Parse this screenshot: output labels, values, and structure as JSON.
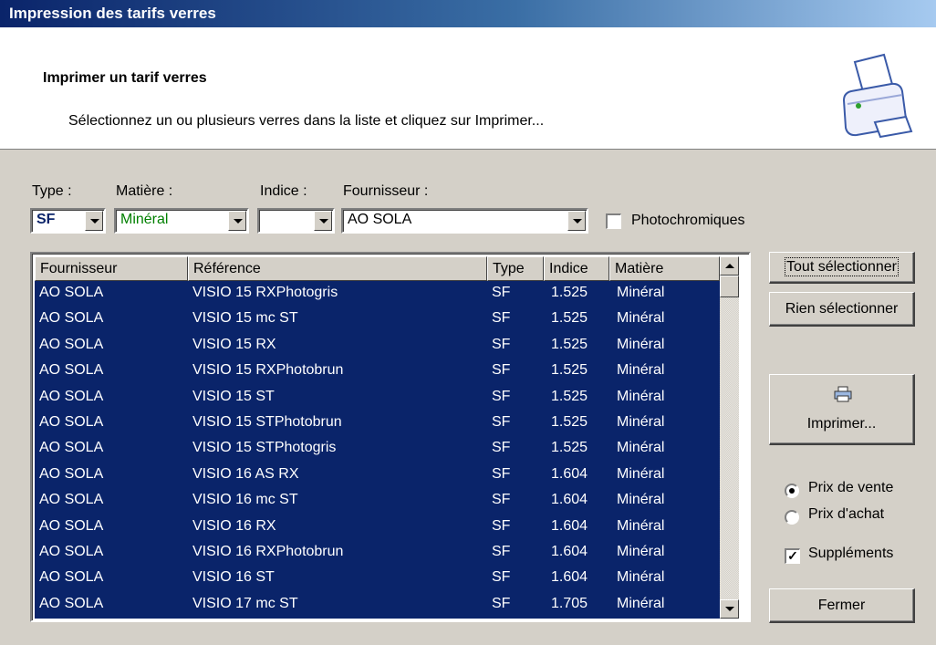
{
  "window": {
    "title": "Impression des tarifs verres"
  },
  "header": {
    "title": "Imprimer un tarif verres",
    "subtitle": "Sélectionnez un ou plusieurs verres dans la liste et cliquez sur Imprimer...",
    "icon": "printer-icon"
  },
  "filters": {
    "type_label": "Type :",
    "type_value": "SF",
    "matiere_label": "Matière :",
    "matiere_value": "Minéral",
    "indice_label": "Indice :",
    "indice_value": "",
    "fournisseur_label": "Fournisseur :",
    "fournisseur_value": "AO SOLA",
    "photochromiques_label": "Photochromiques",
    "photochromiques_checked": false
  },
  "list": {
    "columns": [
      "Fournisseur",
      "Référence",
      "Type",
      "Indice",
      "Matière"
    ],
    "rows": [
      [
        "AO SOLA",
        "VISIO 15  RXPhotogris",
        "SF",
        "1.525",
        "Minéral"
      ],
      [
        "AO SOLA",
        "VISIO 15 mc ST",
        "SF",
        "1.525",
        "Minéral"
      ],
      [
        "AO SOLA",
        "VISIO 15 RX",
        "SF",
        "1.525",
        "Minéral"
      ],
      [
        "AO SOLA",
        "VISIO 15 RXPhotobrun",
        "SF",
        "1.525",
        "Minéral"
      ],
      [
        "AO SOLA",
        "VISIO 15 ST",
        "SF",
        "1.525",
        "Minéral"
      ],
      [
        "AO SOLA",
        "VISIO 15 STPhotobrun",
        "SF",
        "1.525",
        "Minéral"
      ],
      [
        "AO SOLA",
        "VISIO 15 STPhotogris",
        "SF",
        "1.525",
        "Minéral"
      ],
      [
        "AO SOLA",
        "VISIO 16 AS RX",
        "SF",
        "1.604",
        "Minéral"
      ],
      [
        "AO SOLA",
        "VISIO 16 mc ST",
        "SF",
        "1.604",
        "Minéral"
      ],
      [
        "AO SOLA",
        "VISIO 16 RX",
        "SF",
        "1.604",
        "Minéral"
      ],
      [
        "AO SOLA",
        "VISIO 16 RXPhotobrun",
        "SF",
        "1.604",
        "Minéral"
      ],
      [
        "AO SOLA",
        "VISIO 16 ST",
        "SF",
        "1.604",
        "Minéral"
      ],
      [
        "AO SOLA",
        "VISIO 17 mc ST",
        "SF",
        "1.705",
        "Minéral"
      ]
    ]
  },
  "buttons": {
    "select_all": "Tout sélectionner",
    "select_none": "Rien sélectionner",
    "print": "Imprimer...",
    "print_icon": "printer-icon",
    "close": "Fermer"
  },
  "options": {
    "prix_vente": "Prix de vente",
    "prix_achat": "Prix d'achat",
    "selected_price": "Prix de vente",
    "supplements": "Suppléments",
    "supplements_checked": true
  },
  "colors": {
    "selection": "#0a246a",
    "face": "#d4d0c8",
    "matiere_text": "#008000"
  }
}
